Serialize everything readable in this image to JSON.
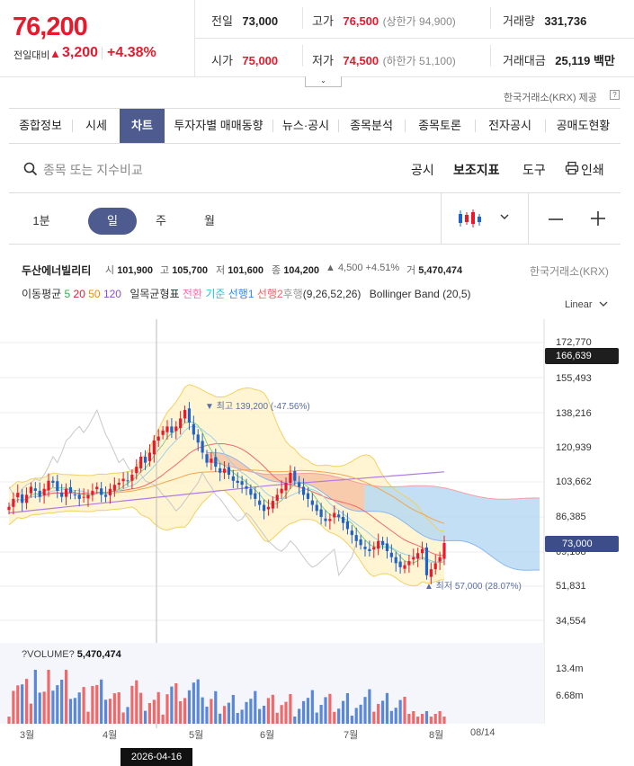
{
  "quote": {
    "price": "76,200",
    "change_label": "전일대비",
    "change_symbol": "▲",
    "change": "3,200",
    "change_pct": "+4.38%",
    "prev_close_label": "전일",
    "prev_close": "73,000",
    "high_label": "고가",
    "high": "76,500",
    "upper_limit": "(상한가 94,900)",
    "volume_label": "거래량",
    "volume": "331,736",
    "open_label": "시가",
    "open": "75,000",
    "low_label": "저가",
    "low": "74,500",
    "lower_limit": "(하한가 51,100)",
    "value_label": "거래대금",
    "value": "25,119 백만"
  },
  "provider": "한국거래소(KRX) 제공",
  "provider_info": "?",
  "expand_arrow": "⌄",
  "tabs": [
    "종합정보",
    "시세",
    "차트",
    "투자자별 매매동향",
    "뉴스·공시",
    "종목분석",
    "종목토론",
    "전자공시",
    "공매도현황"
  ],
  "selected_tab": "차트",
  "toolbar": {
    "search_placeholder": "종목 또는 지수비교",
    "disclosure": "공시",
    "indicators": "보조지표",
    "tools": "도구",
    "print": "인쇄"
  },
  "periods": [
    "1분",
    "일",
    "주",
    "월"
  ],
  "selected_period": "일",
  "chart_header": {
    "name": "두산에너빌리티",
    "open_label": "시",
    "open": "101,900",
    "high_label": "고",
    "high": "105,700",
    "low_label": "저",
    "low": "101,600",
    "close_label": "종",
    "close": "104,200",
    "change": "▲ 4,500 +4.51%",
    "volume_label": "거",
    "volume": "5,470,474",
    "exchange": "한국거래소(KRX)"
  },
  "indicators_legend": {
    "ma_label": "이동평균",
    "ma": [
      {
        "v": "5",
        "color": "#2bb24c"
      },
      {
        "v": "20",
        "color": "#e8192c"
      },
      {
        "v": "50",
        "color": "#f08c00"
      },
      {
        "v": "120",
        "color": "#8a4fd8"
      }
    ],
    "ichimoku_label": "일목균형표",
    "ichimoku": [
      {
        "v": "전환",
        "color": "#ff6fa8"
      },
      {
        "v": "기준",
        "color": "#20c4d8"
      },
      {
        "v": "선행1",
        "color": "#3b82f6"
      },
      {
        "v": "선행2",
        "color": "#f06060"
      },
      {
        "v": "후행",
        "color": "#999999"
      }
    ],
    "ichimoku_params": "(9,26,52,26)",
    "bollinger": "Bollinger Band (20,5)"
  },
  "scale_mode": "Linear",
  "y_ticks": [
    "172,770",
    "155,493",
    "138,216",
    "120,939",
    "103,662",
    "86,385",
    "69,108",
    "51,831",
    "34,554"
  ],
  "current_tag": "166,639",
  "last_tag": "73,000",
  "annotations": {
    "max": "▼ 최고 139,200 (-47.56%)",
    "min": "▲ 최저 57,000 (28.07%)"
  },
  "volume_panel": {
    "label_prefix": "?VOLUME?",
    "value": "5,470,474",
    "ticks": [
      "13.4m",
      "6.68m"
    ]
  },
  "x_ticks": [
    "3월",
    "4월",
    "5월",
    "6월",
    "7월",
    "8월",
    "08/14"
  ],
  "crosshair_date": "2026-04-16",
  "colors": {
    "up": "#e8192c",
    "down": "#1f62c9",
    "accent": "#4d5b8f"
  },
  "chart_data": {
    "type": "candlestick",
    "y_range": [
      34554,
      172770
    ],
    "x_range": [
      "3월",
      "08/14"
    ],
    "grid": true,
    "close_series": [
      91000,
      95000,
      98000,
      93000,
      97000,
      101000,
      99000,
      96000,
      100000,
      104000,
      103000,
      99000,
      96000,
      100000,
      98000,
      97000,
      95000,
      96000,
      97000,
      99000,
      101000,
      97000,
      96000,
      100000,
      102000,
      103000,
      105000,
      104000,
      107000,
      111000,
      116000,
      113000,
      118000,
      124000,
      126000,
      129000,
      131000,
      128000,
      131000,
      135000,
      139200,
      133000,
      127000,
      123000,
      118000,
      113000,
      115000,
      111000,
      108000,
      110000,
      107000,
      104000,
      103000,
      102000,
      100000,
      97000,
      95000,
      92000,
      89000,
      91000,
      94000,
      97000,
      100000,
      103000,
      108000,
      104000,
      101000,
      97000,
      95000,
      92000,
      89000,
      86000,
      84000,
      85000,
      88000,
      86000,
      83000,
      80000,
      77000,
      74000,
      72000,
      70000,
      69000,
      71000,
      74000,
      72000,
      69000,
      66000,
      63000,
      61000,
      62000,
      64000,
      66000,
      68000,
      70000,
      57000,
      60000,
      63000,
      66000,
      73000
    ]
  }
}
